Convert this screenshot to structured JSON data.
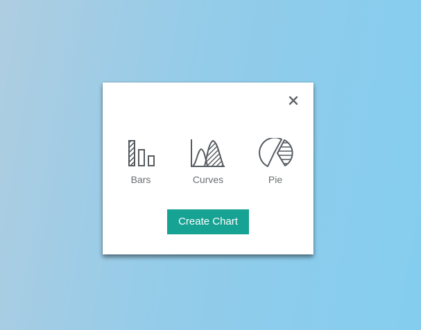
{
  "dialog": {
    "close_icon": "close-icon",
    "options": [
      {
        "label": "Bars",
        "icon": "bar-chart-icon"
      },
      {
        "label": "Curves",
        "icon": "curves-chart-icon"
      },
      {
        "label": "Pie",
        "icon": "pie-chart-icon"
      }
    ],
    "create_button": "Create Chart"
  },
  "colors": {
    "accent": "#17a394",
    "icon": "#555a5f",
    "label": "#6a6d70",
    "background_start": "#aecde1",
    "background_end": "#84cdef"
  }
}
